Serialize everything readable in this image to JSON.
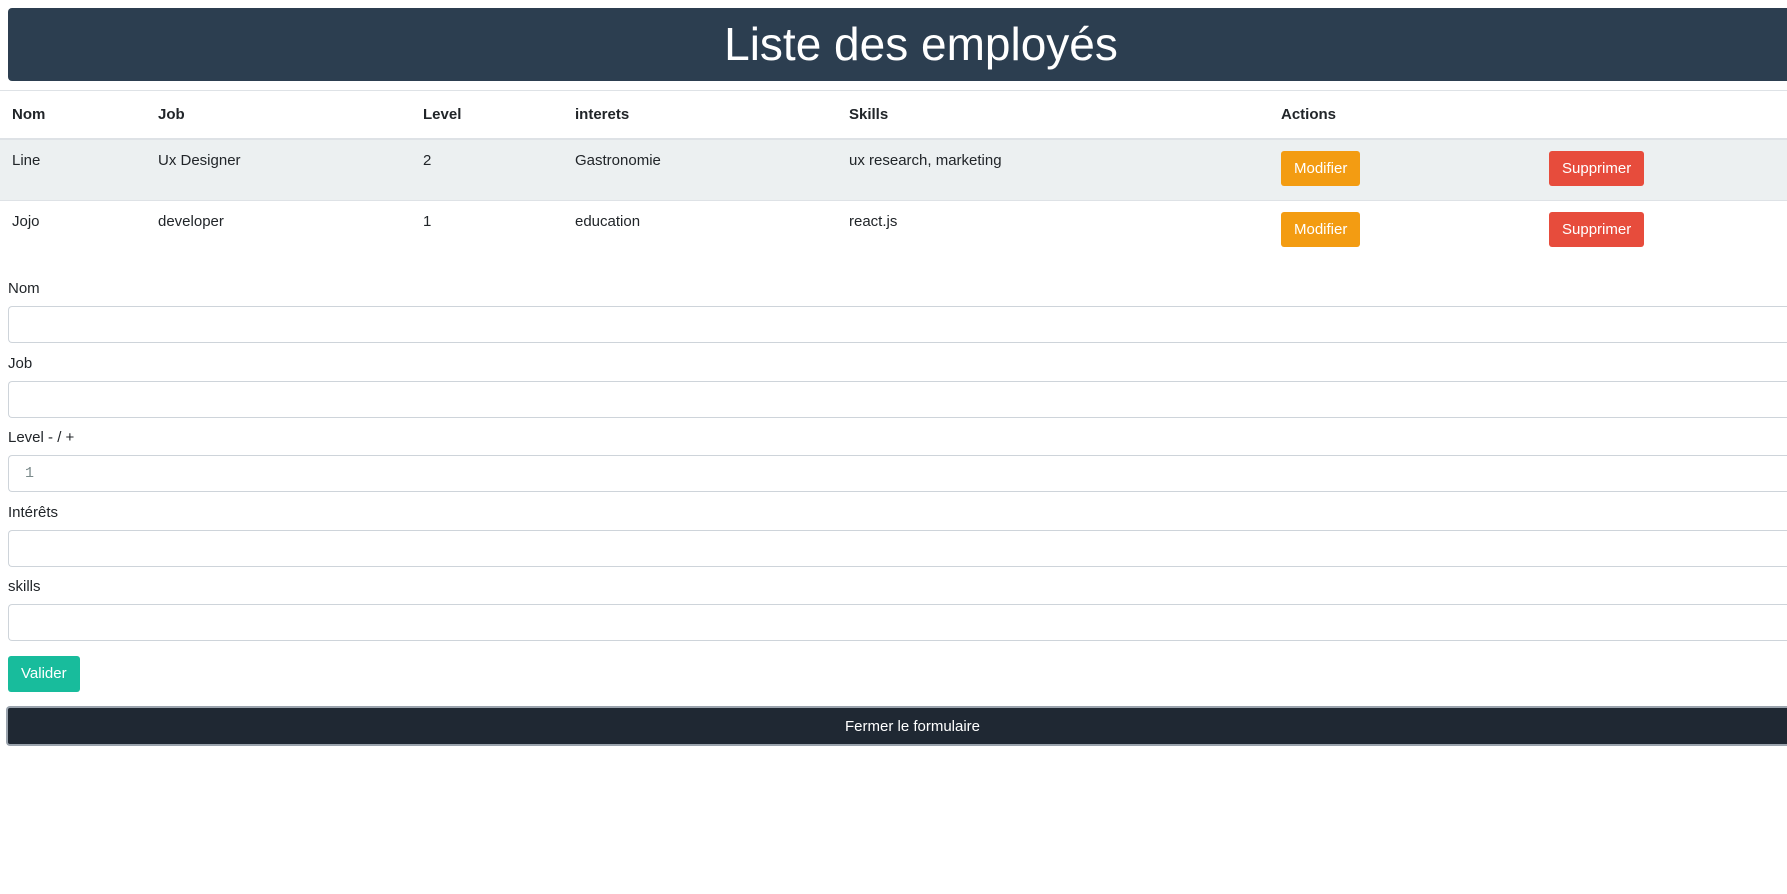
{
  "header": {
    "title": "Liste des employés"
  },
  "table": {
    "columns": [
      "Nom",
      "Job",
      "Level",
      "interets",
      "Skills",
      "Actions"
    ],
    "rows": [
      {
        "nom": "Line",
        "job": "Ux Designer",
        "level": "2",
        "interets": "Gastronomie",
        "skills": "ux research, marketing",
        "edit_label": "Modifier",
        "delete_label": "Supprimer"
      },
      {
        "nom": "Jojo",
        "job": "developer",
        "level": "1",
        "interets": "education",
        "skills": "react.js",
        "edit_label": "Modifier",
        "delete_label": "Supprimer"
      }
    ]
  },
  "form": {
    "nom": {
      "label": "Nom",
      "value": ""
    },
    "job": {
      "label": "Job",
      "value": ""
    },
    "level": {
      "label": "Level - / +",
      "value": "1"
    },
    "interets": {
      "label": "Intérêts",
      "value": ""
    },
    "skills": {
      "label": "skills",
      "value": ""
    },
    "submit_label": "Valider",
    "close_label": "Fermer le formulaire"
  },
  "colors": {
    "header_bg": "#2c3e50",
    "warning": "#f39c12",
    "danger": "#e74c3c",
    "success": "#18bc9c",
    "close_bar": "#1f2833"
  }
}
